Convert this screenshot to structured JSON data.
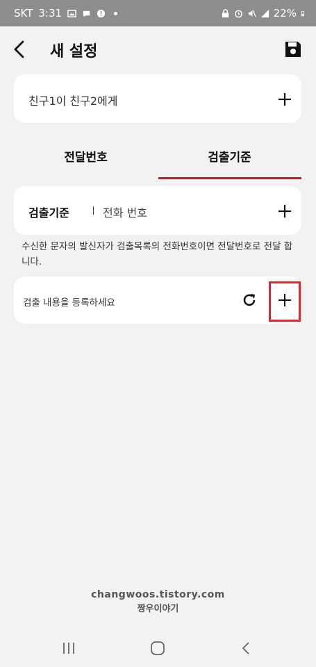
{
  "status_bar": {
    "carrier": "SKT",
    "time": "3:31",
    "battery": "22%",
    "icons": [
      "image-icon",
      "message-icon",
      "alert-icon",
      "dot-icon",
      "lock-icon",
      "alarm-icon",
      "mute-icon",
      "signal-icon",
      "battery-icon"
    ]
  },
  "header": {
    "title": "새 설정",
    "back_icon": "chevron-left-icon",
    "save_icon": "save-icon"
  },
  "recipient": {
    "label": "친구1이 친구2에게",
    "add_icon": "plus-icon"
  },
  "tabs": [
    {
      "label": "전달번호",
      "selected": false
    },
    {
      "label": "검출기준",
      "selected": true
    }
  ],
  "criteria": {
    "label": "검출기준",
    "value": "전화 번호",
    "add_icon": "plus-icon"
  },
  "description": "수신한 문자의 발신자가 검출목록의 전화번호이면 전달번호로 전달 합니다.",
  "entry": {
    "placeholder": "검출 내용을 등록하세요",
    "refresh_icon": "refresh-icon",
    "add_icon": "plus-icon"
  },
  "watermark": {
    "line1": "changwoos.tistory.com",
    "line2": "짱우이야기"
  },
  "nav": {
    "icons": [
      "recent-apps-icon",
      "home-icon",
      "back-icon"
    ]
  },
  "colors": {
    "accent": "#b3262c",
    "highlight": "#e0272f",
    "background": "#f2f2f2",
    "status_bar": "#8d8d8d"
  }
}
